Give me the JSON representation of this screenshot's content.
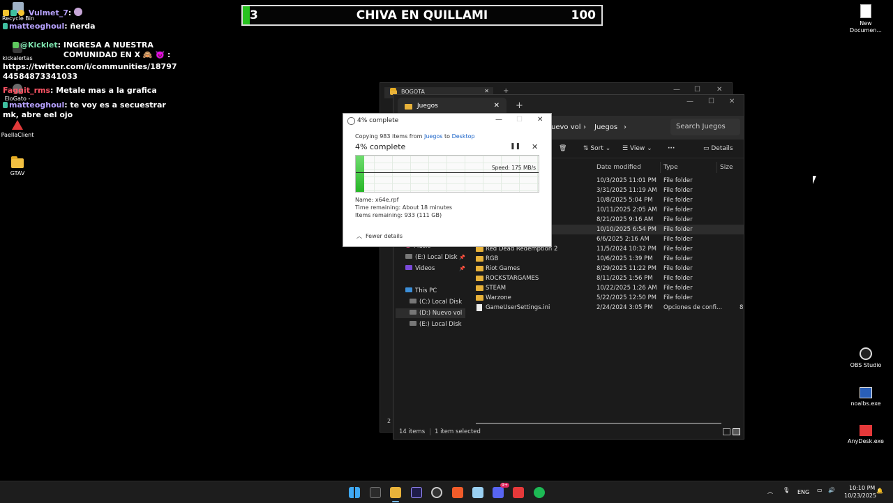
{
  "stream_overlay": {
    "chat": [
      {
        "user": "Vulmet_7",
        "message": ":"
      },
      {
        "user": "matteoghoul",
        "message": "ñerda"
      },
      {
        "user": "@Kicklet",
        "message": "INGRESA A NUESTRA COMUNIDAD EN X 🙈 👿 :"
      },
      {
        "user": "",
        "message": "https://twitter.com/i/communities/18797"
      },
      {
        "user": "",
        "message": "44584873341033"
      },
      {
        "user": "Faggit_rms",
        "message": "Metale mas a la grafica"
      },
      {
        "user": "matteoghoul",
        "message": "te voy es a secuestrar"
      },
      {
        "user": "",
        "message": "mk, abre eel ojo"
      }
    ],
    "banner": {
      "left_number": "3",
      "title": "CHIVA EN QUILLAMI",
      "score": "100"
    }
  },
  "desktop": {
    "left_icons": [
      {
        "label": "Recycle Bin",
        "icon": "recycle-bin-icon"
      },
      {
        "label": "kickalertas",
        "icon": "app-icon"
      },
      {
        "label": "EloGato -",
        "icon": "app-icon"
      },
      {
        "label": "PaellaClient",
        "icon": "paella-icon"
      },
      {
        "label": "GTAV",
        "icon": "folder-icon"
      }
    ],
    "right_icons": [
      {
        "label": "New Documen...",
        "icon": "document-icon"
      },
      {
        "label": "OBS Studio",
        "icon": "obs-icon"
      },
      {
        "label": "noalbs.exe",
        "icon": "exe-icon"
      },
      {
        "label": "AnyDesk.exe",
        "icon": "anydesk-icon"
      }
    ]
  },
  "back_window": {
    "tab": "BOGOTA",
    "status": "2 i"
  },
  "explorer": {
    "tab": "Juegos",
    "breadcrumb": [
      "uevo vol",
      "Juegos"
    ],
    "search_placeholder": "Search Juegos",
    "toolbar": {
      "sort": "Sort",
      "view": "View",
      "more": "···",
      "details": "Details"
    },
    "columns": {
      "date": "Date modified",
      "type": "Type",
      "size": "Size"
    },
    "sidebar": {
      "music": "Music",
      "e_disk_pinned": "(E:) Local Disk",
      "videos": "Videos",
      "this_pc": "This PC",
      "c_disk": "(C:) Local Disk",
      "d_disk": "(D:) Nuevo vol",
      "e_disk": "(E:) Local Disk"
    },
    "rows": [
      {
        "name": "ng",
        "date": "10/3/2025 11:01 PM",
        "type": "File folder",
        "size": "",
        "kind": "folder",
        "hidden_name": true
      },
      {
        "name": "",
        "date": "3/31/2025 11:19 AM",
        "type": "File folder",
        "size": "",
        "kind": "folder",
        "hidden_name": true
      },
      {
        "name": "",
        "date": "10/8/2025 5:04 PM",
        "type": "File folder",
        "size": "",
        "kind": "folder",
        "hidden_name": true
      },
      {
        "name": "",
        "date": "10/11/2025 2:05 AM",
        "type": "File folder",
        "size": "",
        "kind": "folder",
        "hidden_name": true
      },
      {
        "name": "",
        "date": "8/21/2025 9:16 AM",
        "type": "File folder",
        "size": "",
        "kind": "folder",
        "hidden_name": true
      },
      {
        "name": "",
        "date": "10/10/2025 6:54 PM",
        "type": "File folder",
        "size": "",
        "kind": "folder",
        "hidden_name": true,
        "selected": true
      },
      {
        "name": "",
        "date": "6/6/2025 2:16 AM",
        "type": "File folder",
        "size": "",
        "kind": "folder",
        "hidden_name": true
      },
      {
        "name": "Red Dead Redemption 2",
        "date": "11/5/2024 10:32 PM",
        "type": "File folder",
        "size": "",
        "kind": "folder"
      },
      {
        "name": "RGB",
        "date": "10/6/2025 1:39 PM",
        "type": "File folder",
        "size": "",
        "kind": "folder"
      },
      {
        "name": "Riot Games",
        "date": "8/29/2025 11:22 PM",
        "type": "File folder",
        "size": "",
        "kind": "folder"
      },
      {
        "name": "ROCKSTARGAMES",
        "date": "8/11/2025 1:56 PM",
        "type": "File folder",
        "size": "",
        "kind": "folder"
      },
      {
        "name": "STEAM",
        "date": "10/22/2025 1:26 AM",
        "type": "File folder",
        "size": "",
        "kind": "folder"
      },
      {
        "name": "Warzone",
        "date": "5/22/2025 12:50 PM",
        "type": "File folder",
        "size": "",
        "kind": "folder"
      },
      {
        "name": "GameUserSettings.ini",
        "date": "2/24/2024 3:05 PM",
        "type": "Opciones de confi...",
        "size": "8",
        "kind": "file"
      }
    ],
    "status": {
      "items": "14 items",
      "selected": "1 item selected"
    }
  },
  "copy_dialog": {
    "title": "4% complete",
    "copying_prefix": "Copying 983 items from",
    "source": "Juegos",
    "to": "to",
    "destination": "Desktop",
    "heading": "4% complete",
    "progress_fraction": 0.04,
    "speed": "Speed: 175 MB/s",
    "name_label": "Name:",
    "name_value": "x64e.rpf",
    "time_label": "Time remaining:",
    "time_value": "About 18 minutes",
    "items_label": "Items remaining:",
    "items_value": "933 (111 GB)",
    "fewer_details": "Fewer details"
  },
  "taskbar": {
    "apps": [
      "windows-start-icon",
      "epic-games-icon",
      "file-explorer-icon",
      "premiere-icon",
      "obs-icon",
      "brave-icon",
      "notepad-icon",
      "discord-icon",
      "anydesk-icon",
      "spotify-icon"
    ],
    "discord_badge": "9+",
    "language": "ENG",
    "time": "10:10 PM",
    "date": "10/23/2025"
  },
  "colors": {
    "accent_green": "#27c21f",
    "progress_green": "#27b627",
    "link_blue": "#1a63c8",
    "folder_yellow": "#e8b23a"
  }
}
